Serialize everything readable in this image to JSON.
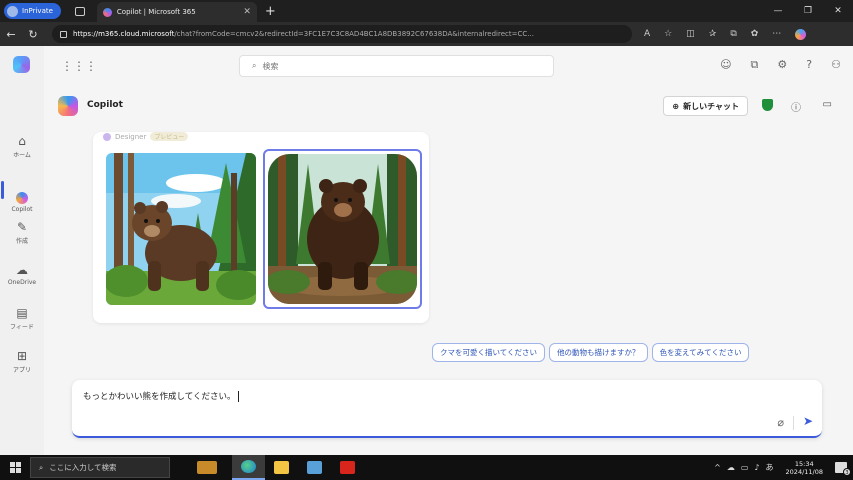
{
  "browser": {
    "inprivate_label": "InPrivate",
    "tab_title": "Copilot | Microsoft 365",
    "tab_close": "✕",
    "new_tab": "+",
    "url_host": "https://m365.cloud.microsoft",
    "url_rest": "/chat?fromCode=cmcv2&redirectId=3FC1E7C3C8AD4BC1A8DB3892C67638DA&internalredirect=CC...",
    "window_controls": [
      "—",
      "❐",
      "✕"
    ]
  },
  "rail": {
    "items": [
      {
        "label": "ホーム",
        "icon": "⌂"
      },
      {
        "label": "Copilot",
        "icon": "●"
      },
      {
        "label": "作成",
        "icon": "✎"
      },
      {
        "label": "OneDrive",
        "icon": "☁"
      },
      {
        "label": "フィード",
        "icon": "▤"
      },
      {
        "label": "アプリ",
        "icon": "⊞"
      }
    ]
  },
  "topbar": {
    "search_placeholder": "検索",
    "icons": [
      "☺",
      "⧉",
      "⚙",
      "?",
      "⚇"
    ]
  },
  "chat": {
    "title": "Copilot",
    "new_chat_label": "新しいチャット",
    "designer_label": "Designer",
    "designer_pill": "プレビュー"
  },
  "suggestions": [
    "クマを可愛く描いてください",
    "他の動物も描けますか？",
    "色を変えてみてください"
  ],
  "composer": {
    "text": "もっとかわいい熊を作成してください。"
  },
  "taskbar": {
    "search_placeholder": "ここに入力して検索",
    "time": "15:34",
    "date": "2024/11/08",
    "notification_count": "3",
    "tray_icons": [
      "^",
      "☁",
      "▭",
      "♪",
      "あ"
    ]
  }
}
